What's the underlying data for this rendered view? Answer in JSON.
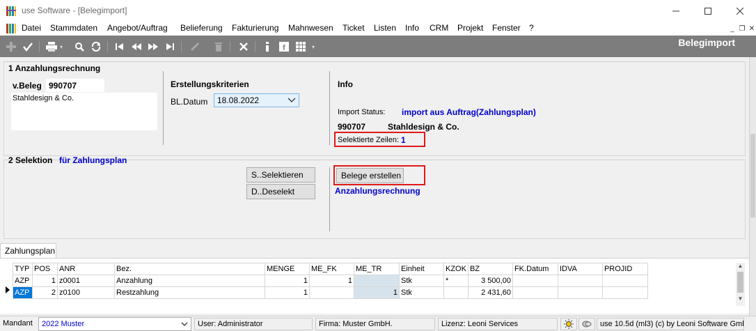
{
  "window": {
    "title": "use Software - [Belegimport]"
  },
  "menu": {
    "items": [
      "Datei",
      "Stammdaten",
      "Angebot/Auftrag",
      "Belieferung",
      "Fakturierung",
      "Mahnwesen",
      "Ticket",
      "Listen",
      "Info",
      "CRM",
      "Projekt",
      "Fenster",
      "?"
    ]
  },
  "toolbar": {
    "page_title": "Belegimport"
  },
  "section1": {
    "title": "1 Anzahlungsrechnung",
    "vbeleg_label": "v.Beleg",
    "vbeleg_value": "990707",
    "customer_name": "Stahldesign & Co."
  },
  "criteria": {
    "title": "Erstellungskriterien",
    "bldatum_label": "BL.Datum",
    "bldatum_value": "18.08.2022"
  },
  "info": {
    "title": "Info",
    "import_status_label": "Import Status:",
    "import_status_value": "import aus Auftrag(Zahlungsplan)",
    "beleg_number": "990707",
    "beleg_customer": "Stahldesign & Co.",
    "selected_rows_label": "Selektierte Zeilen:",
    "selected_rows_value": "1"
  },
  "section2": {
    "title": "2 Selektion",
    "subtitle": "für Zahlungsplan",
    "select_button": "S..Selektieren",
    "deselect_button": "D..Deselekt",
    "create_button": "Belege erstellen",
    "create_subtitle": "Anzahlungsrechnung"
  },
  "tab": {
    "label": "Zahlungsplan"
  },
  "grid": {
    "columns": [
      "TYP",
      "POS",
      "ANR",
      "Bez.",
      "MENGE",
      "ME_FK",
      "ME_TR",
      "Einheit",
      "KZOK",
      "BZ",
      "FK.Datum",
      "IDVA",
      "PROJID"
    ],
    "rows": [
      [
        "AZP",
        "1",
        "z0001",
        "Anzahlung",
        "1",
        "1",
        "",
        "Stk",
        "*",
        "3 500,00",
        "",
        "",
        ""
      ],
      [
        "AZP",
        "2",
        "z0100",
        "Restzahlung",
        "1",
        "",
        "1",
        "Stk",
        "",
        "2 431,60",
        "",
        "",
        ""
      ]
    ]
  },
  "statusbar": {
    "mandant_label": "Mandant",
    "mandant_value": "2022 Muster",
    "user": "User: Administrator",
    "firma": "Firma: Muster GmbH.",
    "lizenz": "Lizenz: Leoni Services",
    "version": "use 10.5d (ml3) (c) by Leoni Software Gmb"
  },
  "colors": {
    "toolbar_bg": "#7d7d7d",
    "accent_blue": "#0000cc",
    "highlight_red": "#e01818",
    "selection_blue": "#0078d7"
  }
}
